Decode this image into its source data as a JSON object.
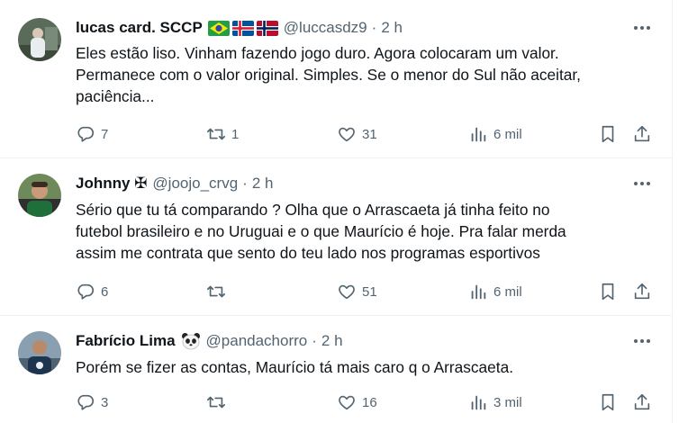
{
  "tweets": [
    {
      "name": "lucas card. SCCP",
      "flags": [
        "br-flag",
        "is-flag",
        "no-flag"
      ],
      "handle": "@luccasdz9",
      "dot": "·",
      "time": "2 h",
      "text": "Eles estão liso. Vinham fazendo jogo duro. Agora colocaram um valor.\nPermanece com o valor original. Simples. Se o menor do Sul não aceitar,\npaciência...",
      "replies": "7",
      "retweets": "1",
      "likes": "31",
      "views": "6 mil"
    },
    {
      "name": "Johnny ✠",
      "flags": [],
      "handle": "@joojo_crvg",
      "dot": "·",
      "time": "2 h",
      "text": "Sério que tu tá comparando ? Olha que o Arrascaeta já tinha feito no\nfutebol brasileiro e no Uruguai e o que Maurício é hoje. Pra falar merda\nassim me contrata que sento do teu lado nos programas esportivos",
      "replies": "6",
      "retweets": "",
      "likes": "51",
      "views": "6 mil"
    },
    {
      "name": "Fabrício Lima",
      "flags": [
        "panda-emoji"
      ],
      "handle": "@pandachorro",
      "dot": "·",
      "time": "2 h",
      "text": "Porém se fizer as contas, Maurício tá mais caro q o Arrascaeta.",
      "replies": "3",
      "retweets": "",
      "likes": "16",
      "views": "3 mil"
    }
  ],
  "colors": {
    "text": "#0f1419",
    "muted": "#536471",
    "divider": "#eff3f4"
  },
  "icons": [
    "reply-icon",
    "retweet-icon",
    "like-icon",
    "views-icon",
    "bookmark-icon",
    "share-icon",
    "more-icon"
  ]
}
